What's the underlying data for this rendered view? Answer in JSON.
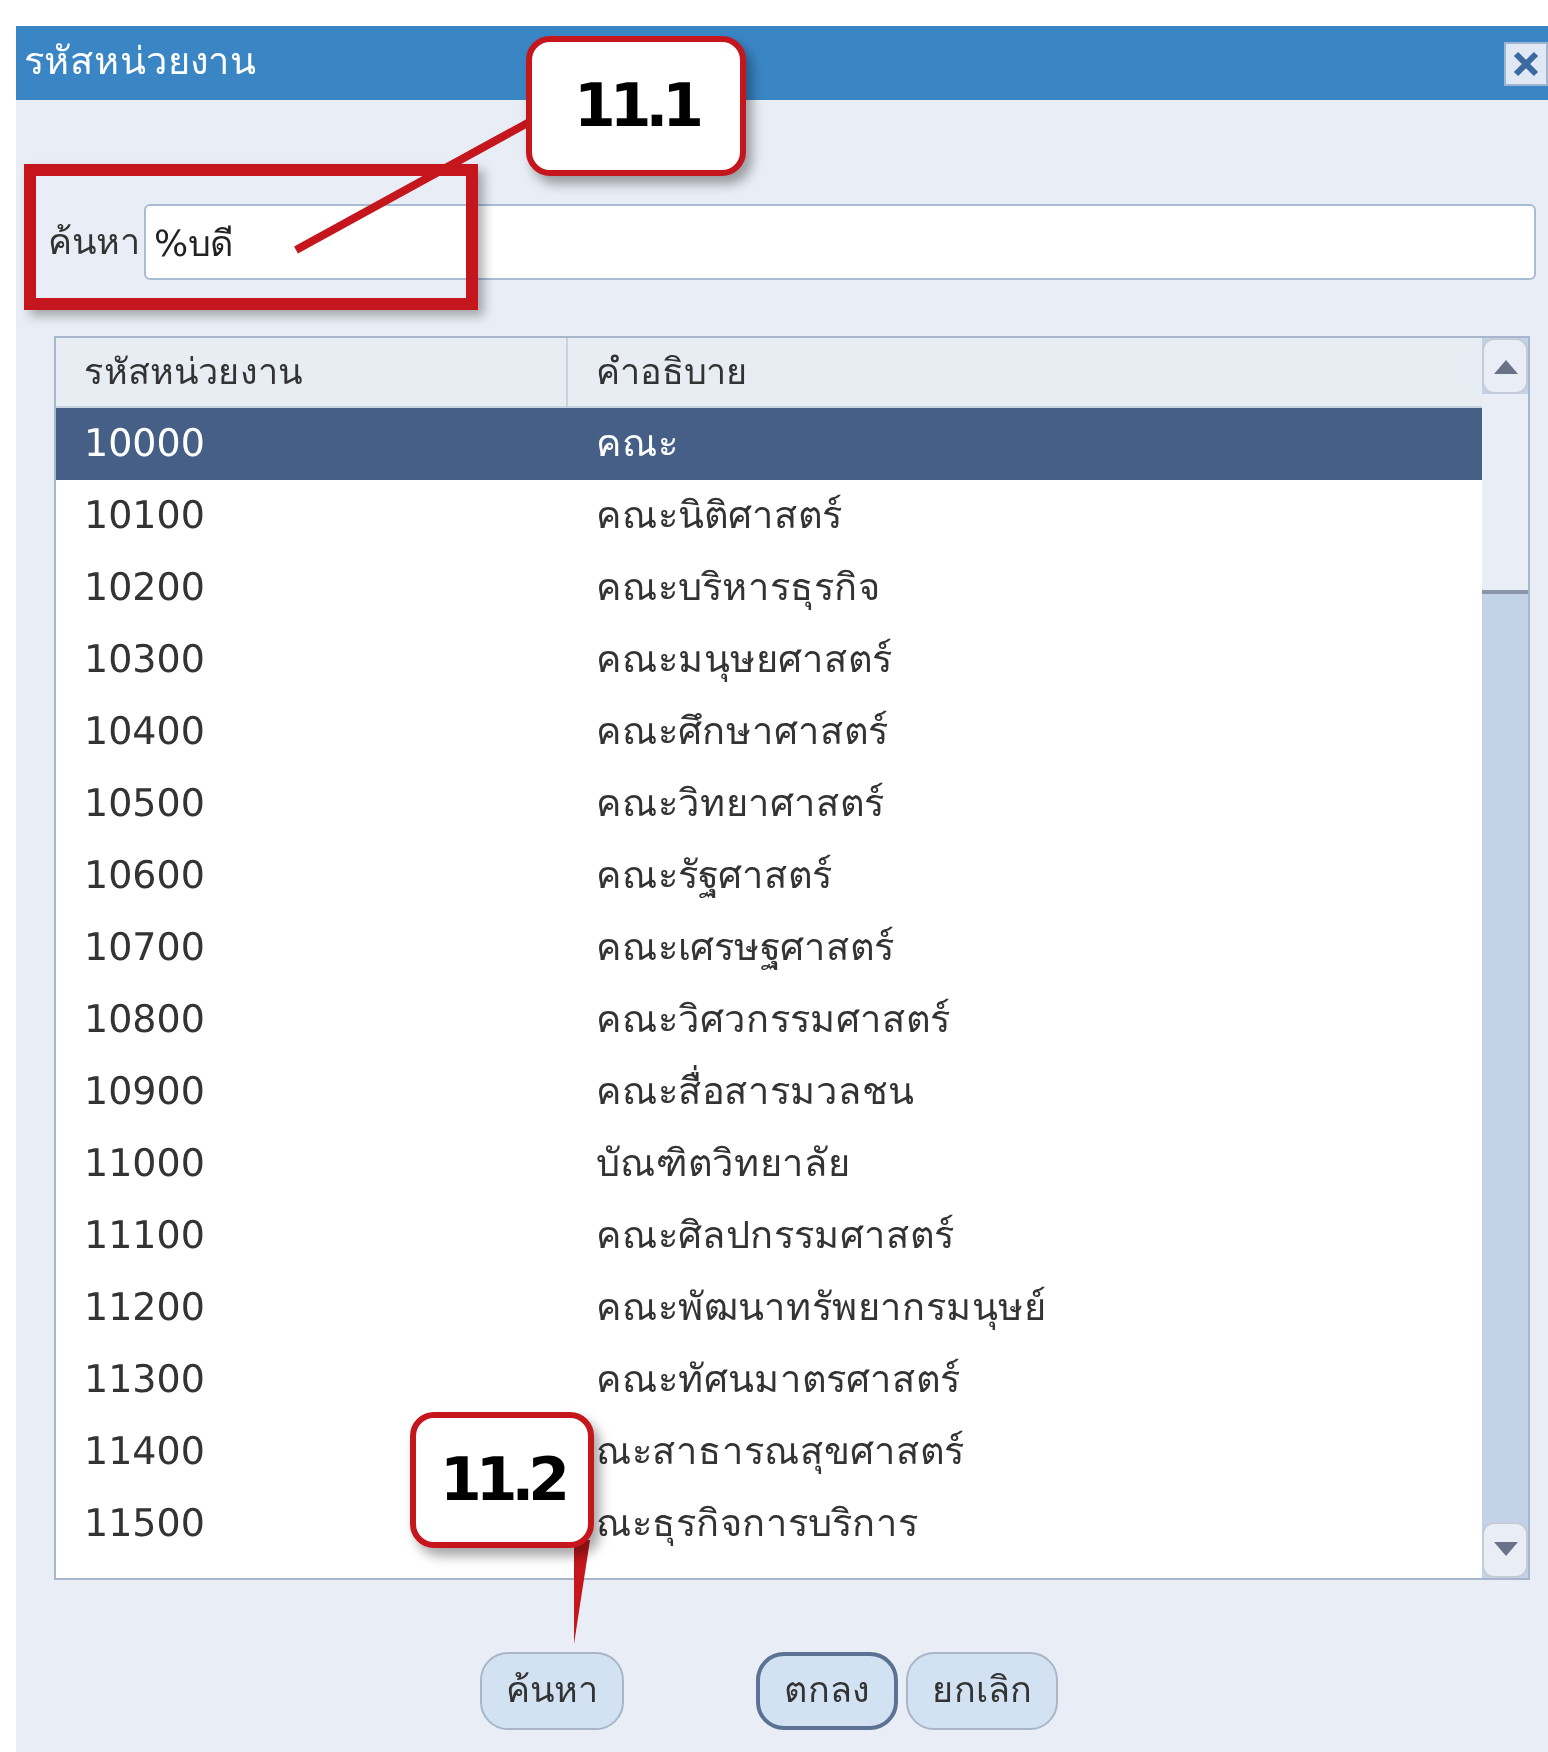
{
  "window": {
    "title": "รหัสหน่วยงาน"
  },
  "search": {
    "label": "ค้นหา",
    "value": "%บดี"
  },
  "table": {
    "columns": [
      "รหัสหน่วยงาน",
      "คำอธิบาย"
    ],
    "rows": [
      {
        "code": "10000",
        "description": "คณะ",
        "selected": true
      },
      {
        "code": "10100",
        "description": "คณะนิติศาสตร์",
        "selected": false
      },
      {
        "code": "10200",
        "description": "คณะบริหารธุรกิจ",
        "selected": false
      },
      {
        "code": "10300",
        "description": "คณะมนุษยศาสตร์",
        "selected": false
      },
      {
        "code": "10400",
        "description": "คณะศึกษาศาสตร์",
        "selected": false
      },
      {
        "code": "10500",
        "description": "คณะวิทยาศาสตร์",
        "selected": false
      },
      {
        "code": "10600",
        "description": "คณะรัฐศาสตร์",
        "selected": false
      },
      {
        "code": "10700",
        "description": "คณะเศรษฐศาสตร์",
        "selected": false
      },
      {
        "code": "10800",
        "description": "คณะวิศวกรรมศาสตร์",
        "selected": false
      },
      {
        "code": "10900",
        "description": "คณะสื่อสารมวลชน",
        "selected": false
      },
      {
        "code": "11000",
        "description": "บัณฑิตวิทยาลัย",
        "selected": false
      },
      {
        "code": "11100",
        "description": "คณะศิลปกรรมศาสตร์",
        "selected": false
      },
      {
        "code": "11200",
        "description": "คณะพัฒนาทรัพยากรมนุษย์",
        "selected": false
      },
      {
        "code": "11300",
        "description": "คณะทัศนมาตรศาสตร์",
        "selected": false
      },
      {
        "code": "11400",
        "description": "ณะสาธารณสุขศาสตร์",
        "selected": false
      },
      {
        "code": "11500",
        "description": "ณะธุรกิจการบริการ",
        "selected": false
      }
    ]
  },
  "buttons": [
    {
      "label": "ค้นหา",
      "default": false
    },
    {
      "label": "ตกลง",
      "default": true
    },
    {
      "label": "ยกเลิก",
      "default": false
    }
  ],
  "callouts": [
    {
      "label": "11.1"
    },
    {
      "label": "11.2"
    }
  ]
}
